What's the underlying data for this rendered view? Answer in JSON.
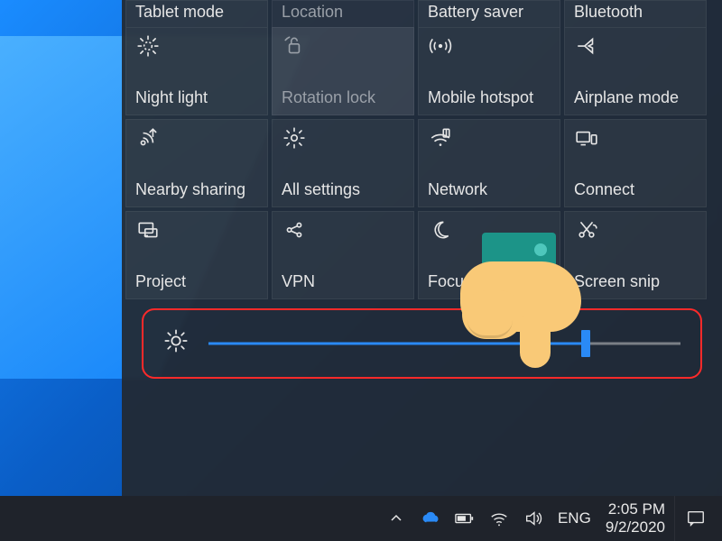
{
  "partial_row": [
    {
      "label": "Tablet mode",
      "icon": "tablet-icon",
      "disabled": false
    },
    {
      "label": "Location",
      "icon": "location-icon",
      "disabled": true
    },
    {
      "label": "Battery saver",
      "icon": "battery-icon",
      "disabled": false
    },
    {
      "label": "Bluetooth",
      "icon": "bluetooth-icon",
      "disabled": false
    }
  ],
  "rows": [
    [
      {
        "label": "Night light",
        "icon": "night-light-icon",
        "disabled": false
      },
      {
        "label": "Rotation lock",
        "icon": "rotation-lock-icon",
        "disabled": true,
        "hovered": true
      },
      {
        "label": "Mobile hotspot",
        "icon": "hotspot-icon",
        "disabled": false
      },
      {
        "label": "Airplane mode",
        "icon": "airplane-icon",
        "disabled": false
      }
    ],
    [
      {
        "label": "Nearby sharing",
        "icon": "nearby-sharing-icon",
        "disabled": false
      },
      {
        "label": "All settings",
        "icon": "settings-icon",
        "disabled": false
      },
      {
        "label": "Network",
        "icon": "network-icon",
        "disabled": false
      },
      {
        "label": "Connect",
        "icon": "connect-icon",
        "disabled": false
      }
    ],
    [
      {
        "label": "Project",
        "icon": "project-icon",
        "disabled": false
      },
      {
        "label": "VPN",
        "icon": "vpn-icon",
        "disabled": false
      },
      {
        "label": "Focus assist",
        "icon": "focus-assist-icon",
        "disabled": false
      },
      {
        "label": "Screen snip",
        "icon": "screen-snip-icon",
        "disabled": false
      }
    ]
  ],
  "brightness": {
    "percent": 80
  },
  "taskbar": {
    "language": "ENG",
    "time": "2:05 PM",
    "date": "9/2/2020"
  }
}
